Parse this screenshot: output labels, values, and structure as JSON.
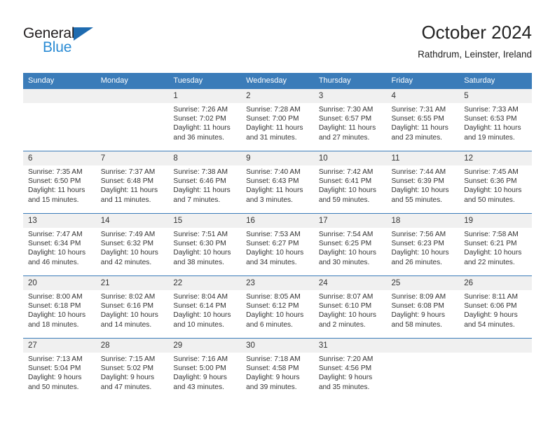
{
  "brand": {
    "name_top": "General",
    "name_bottom": "Blue",
    "triangle_color": "#1e6bb0",
    "blue_color": "#2a8bd4",
    "dark_color": "#231f20"
  },
  "header": {
    "title": "October 2024",
    "location": "Rathdrum, Leinster, Ireland"
  },
  "theme": {
    "header_blue": "#3b7cb9",
    "daynum_band": "#f0f0f0",
    "text": "#333333"
  },
  "weekdays": [
    "Sunday",
    "Monday",
    "Tuesday",
    "Wednesday",
    "Thursday",
    "Friday",
    "Saturday"
  ],
  "labels": {
    "sunrise": "Sunrise:",
    "sunset": "Sunset:",
    "daylight": "Daylight:"
  },
  "weeks": [
    [
      {
        "day": "",
        "blank": true
      },
      {
        "day": "",
        "blank": true
      },
      {
        "day": "1",
        "sunrise": "Sunrise: 7:26 AM",
        "sunset": "Sunset: 7:02 PM",
        "daylight": "Daylight: 11 hours and 36 minutes."
      },
      {
        "day": "2",
        "sunrise": "Sunrise: 7:28 AM",
        "sunset": "Sunset: 7:00 PM",
        "daylight": "Daylight: 11 hours and 31 minutes."
      },
      {
        "day": "3",
        "sunrise": "Sunrise: 7:30 AM",
        "sunset": "Sunset: 6:57 PM",
        "daylight": "Daylight: 11 hours and 27 minutes."
      },
      {
        "day": "4",
        "sunrise": "Sunrise: 7:31 AM",
        "sunset": "Sunset: 6:55 PM",
        "daylight": "Daylight: 11 hours and 23 minutes."
      },
      {
        "day": "5",
        "sunrise": "Sunrise: 7:33 AM",
        "sunset": "Sunset: 6:53 PM",
        "daylight": "Daylight: 11 hours and 19 minutes."
      }
    ],
    [
      {
        "day": "6",
        "sunrise": "Sunrise: 7:35 AM",
        "sunset": "Sunset: 6:50 PM",
        "daylight": "Daylight: 11 hours and 15 minutes."
      },
      {
        "day": "7",
        "sunrise": "Sunrise: 7:37 AM",
        "sunset": "Sunset: 6:48 PM",
        "daylight": "Daylight: 11 hours and 11 minutes."
      },
      {
        "day": "8",
        "sunrise": "Sunrise: 7:38 AM",
        "sunset": "Sunset: 6:46 PM",
        "daylight": "Daylight: 11 hours and 7 minutes."
      },
      {
        "day": "9",
        "sunrise": "Sunrise: 7:40 AM",
        "sunset": "Sunset: 6:43 PM",
        "daylight": "Daylight: 11 hours and 3 minutes."
      },
      {
        "day": "10",
        "sunrise": "Sunrise: 7:42 AM",
        "sunset": "Sunset: 6:41 PM",
        "daylight": "Daylight: 10 hours and 59 minutes."
      },
      {
        "day": "11",
        "sunrise": "Sunrise: 7:44 AM",
        "sunset": "Sunset: 6:39 PM",
        "daylight": "Daylight: 10 hours and 55 minutes."
      },
      {
        "day": "12",
        "sunrise": "Sunrise: 7:45 AM",
        "sunset": "Sunset: 6:36 PM",
        "daylight": "Daylight: 10 hours and 50 minutes."
      }
    ],
    [
      {
        "day": "13",
        "sunrise": "Sunrise: 7:47 AM",
        "sunset": "Sunset: 6:34 PM",
        "daylight": "Daylight: 10 hours and 46 minutes."
      },
      {
        "day": "14",
        "sunrise": "Sunrise: 7:49 AM",
        "sunset": "Sunset: 6:32 PM",
        "daylight": "Daylight: 10 hours and 42 minutes."
      },
      {
        "day": "15",
        "sunrise": "Sunrise: 7:51 AM",
        "sunset": "Sunset: 6:30 PM",
        "daylight": "Daylight: 10 hours and 38 minutes."
      },
      {
        "day": "16",
        "sunrise": "Sunrise: 7:53 AM",
        "sunset": "Sunset: 6:27 PM",
        "daylight": "Daylight: 10 hours and 34 minutes."
      },
      {
        "day": "17",
        "sunrise": "Sunrise: 7:54 AM",
        "sunset": "Sunset: 6:25 PM",
        "daylight": "Daylight: 10 hours and 30 minutes."
      },
      {
        "day": "18",
        "sunrise": "Sunrise: 7:56 AM",
        "sunset": "Sunset: 6:23 PM",
        "daylight": "Daylight: 10 hours and 26 minutes."
      },
      {
        "day": "19",
        "sunrise": "Sunrise: 7:58 AM",
        "sunset": "Sunset: 6:21 PM",
        "daylight": "Daylight: 10 hours and 22 minutes."
      }
    ],
    [
      {
        "day": "20",
        "sunrise": "Sunrise: 8:00 AM",
        "sunset": "Sunset: 6:18 PM",
        "daylight": "Daylight: 10 hours and 18 minutes."
      },
      {
        "day": "21",
        "sunrise": "Sunrise: 8:02 AM",
        "sunset": "Sunset: 6:16 PM",
        "daylight": "Daylight: 10 hours and 14 minutes."
      },
      {
        "day": "22",
        "sunrise": "Sunrise: 8:04 AM",
        "sunset": "Sunset: 6:14 PM",
        "daylight": "Daylight: 10 hours and 10 minutes."
      },
      {
        "day": "23",
        "sunrise": "Sunrise: 8:05 AM",
        "sunset": "Sunset: 6:12 PM",
        "daylight": "Daylight: 10 hours and 6 minutes."
      },
      {
        "day": "24",
        "sunrise": "Sunrise: 8:07 AM",
        "sunset": "Sunset: 6:10 PM",
        "daylight": "Daylight: 10 hours and 2 minutes."
      },
      {
        "day": "25",
        "sunrise": "Sunrise: 8:09 AM",
        "sunset": "Sunset: 6:08 PM",
        "daylight": "Daylight: 9 hours and 58 minutes."
      },
      {
        "day": "26",
        "sunrise": "Sunrise: 8:11 AM",
        "sunset": "Sunset: 6:06 PM",
        "daylight": "Daylight: 9 hours and 54 minutes."
      }
    ],
    [
      {
        "day": "27",
        "sunrise": "Sunrise: 7:13 AM",
        "sunset": "Sunset: 5:04 PM",
        "daylight": "Daylight: 9 hours and 50 minutes."
      },
      {
        "day": "28",
        "sunrise": "Sunrise: 7:15 AM",
        "sunset": "Sunset: 5:02 PM",
        "daylight": "Daylight: 9 hours and 47 minutes."
      },
      {
        "day": "29",
        "sunrise": "Sunrise: 7:16 AM",
        "sunset": "Sunset: 5:00 PM",
        "daylight": "Daylight: 9 hours and 43 minutes."
      },
      {
        "day": "30",
        "sunrise": "Sunrise: 7:18 AM",
        "sunset": "Sunset: 4:58 PM",
        "daylight": "Daylight: 9 hours and 39 minutes."
      },
      {
        "day": "31",
        "sunrise": "Sunrise: 7:20 AM",
        "sunset": "Sunset: 4:56 PM",
        "daylight": "Daylight: 9 hours and 35 minutes."
      },
      {
        "day": "",
        "blank": true
      },
      {
        "day": "",
        "blank": true
      }
    ]
  ]
}
